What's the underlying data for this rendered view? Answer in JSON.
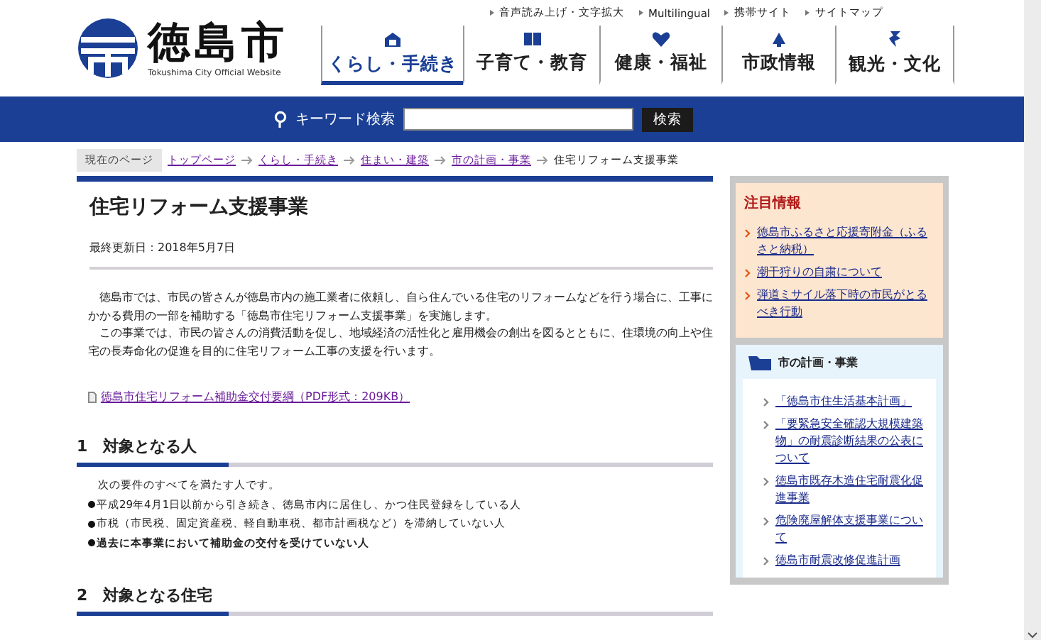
{
  "header": {
    "logo_name": "徳島市",
    "logo_subtitle": "Tokushima City Official Website",
    "utility_links": [
      "音声読み上げ・文字拡大",
      "Multilingual",
      "携帯サイト",
      "サイトマップ"
    ],
    "nav": [
      {
        "label": "くらし・手続き",
        "selected": true
      },
      {
        "label": "子育て・教育",
        "selected": false
      },
      {
        "label": "健康・福祉",
        "selected": false
      },
      {
        "label": "市政情報",
        "selected": false
      },
      {
        "label": "観光・文化",
        "selected": false
      }
    ]
  },
  "search": {
    "label": "キーワード検索",
    "button": "検索"
  },
  "breadcrumb": {
    "label": "現在のページ",
    "links": [
      "トップページ",
      "くらし・手続き",
      "住まい・建築",
      "市の計画・事業"
    ],
    "current": "住宅リフォーム支援事業"
  },
  "article": {
    "title": "住宅リフォーム支援事業",
    "updated": "最終更新日：2018年5月7日",
    "paragraphs": [
      "徳島市では、市民の皆さんが徳島市内の施工業者に依頼し、自ら住んでいる住宅のリフォームなどを行う場合に、工事にかかる費用の一部を補助する「徳島市住宅リフォーム支援事業」を実施します。",
      "この事業では、市民の皆さんの消費活動を促し、地域経済の活性化と雇用機会の創出を図るとともに、住環境の向上や住宅の長寿命化の促進を目的に住宅リフォーム工事の支援を行います。"
    ],
    "attachment": "徳島市住宅リフォーム補助金交付要綱（PDF形式：209KB）",
    "sections": [
      {
        "heading": "1　対象となる人",
        "intro": "次の要件のすべてを満たす人です。",
        "bullets": [
          {
            "text": "平成29年4月1日以前から引き続き、徳島市内に居住し、かつ住民登録をしている人",
            "bold": false
          },
          {
            "text": "市税（市民税、固定資産税、軽自動車税、都市計画税など）を滞納していない人",
            "bold": false
          },
          {
            "text": "過去に本事業において補助金の交付を受けていない人",
            "bold": true
          }
        ]
      },
      {
        "heading": "2　対象となる住宅"
      }
    ]
  },
  "sidebar": {
    "notice": {
      "title": "注目情報",
      "links": [
        "徳島市ふるさと応援寄附金（ふるさと納税）",
        "潮干狩りの自粛について",
        "弾道ミサイル落下時の市民がとるべき行動"
      ]
    },
    "related": {
      "title": "市の計画・事業",
      "links": [
        "「徳島市住生活基本計画」",
        "「要緊急安全確認大規模建築物」の耐震診断結果の公表について",
        "徳島市既存木造住宅耐震化促進事業",
        "危険廃屋解体支援事業について",
        "徳島市耐震改修促進計画"
      ]
    }
  }
}
